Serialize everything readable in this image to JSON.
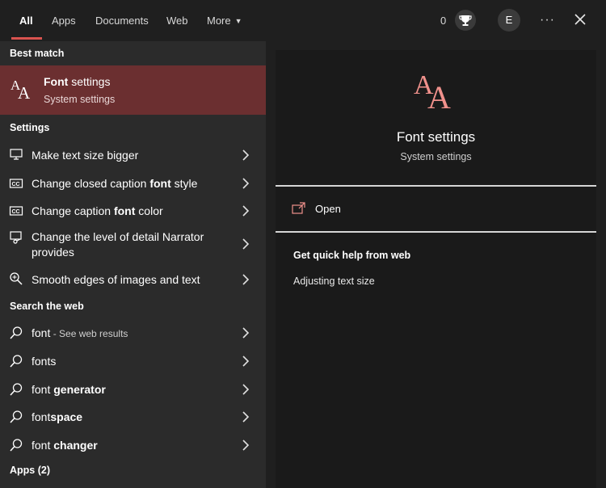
{
  "tabs": [
    {
      "label": "All",
      "active": true
    },
    {
      "label": "Apps"
    },
    {
      "label": "Documents"
    },
    {
      "label": "Web"
    },
    {
      "label": "More"
    }
  ],
  "header": {
    "points": "0",
    "avatar_initial": "E",
    "more_options": "···",
    "accent_color": "#d9534f"
  },
  "best_match": {
    "section_title": "Best match",
    "title_bold": "Font",
    "title_rest": " settings",
    "subtitle": "System settings",
    "highlight_color": "#6b2f30"
  },
  "settings": {
    "section_title": "Settings",
    "items": [
      {
        "icon": "monitor-icon",
        "pre": "Make text size bigger",
        "bold": "",
        "post": ""
      },
      {
        "icon": "closed-caption-icon",
        "pre": "Change closed caption ",
        "bold": "font",
        "post": " style"
      },
      {
        "icon": "closed-caption-icon",
        "pre": "Change caption ",
        "bold": "font",
        "post": " color"
      },
      {
        "icon": "narrator-icon",
        "pre": "Change the level of detail Narrator provides",
        "bold": "",
        "post": ""
      },
      {
        "icon": "magnifier-plus-icon",
        "pre": "Smooth edges of images and text",
        "bold": "",
        "post": ""
      }
    ]
  },
  "web": {
    "section_title": "Search the web",
    "items": [
      {
        "pre": "font",
        "bold": "",
        "post": "",
        "suffix": " - See web results"
      },
      {
        "pre": "fonts",
        "bold": "",
        "post": "",
        "suffix": ""
      },
      {
        "pre": "font ",
        "bold": "generator",
        "post": "",
        "suffix": ""
      },
      {
        "pre": "font",
        "bold": "space",
        "post": "",
        "suffix": ""
      },
      {
        "pre": "font ",
        "bold": "changer",
        "post": "",
        "suffix": ""
      }
    ]
  },
  "apps": {
    "section_title": "Apps (2)"
  },
  "preview": {
    "title": "Font settings",
    "subtitle": "System settings",
    "open_label": "Open",
    "help_title": "Get quick help from web",
    "help_link": "Adjusting text size",
    "icon_color": "#f0918c"
  }
}
